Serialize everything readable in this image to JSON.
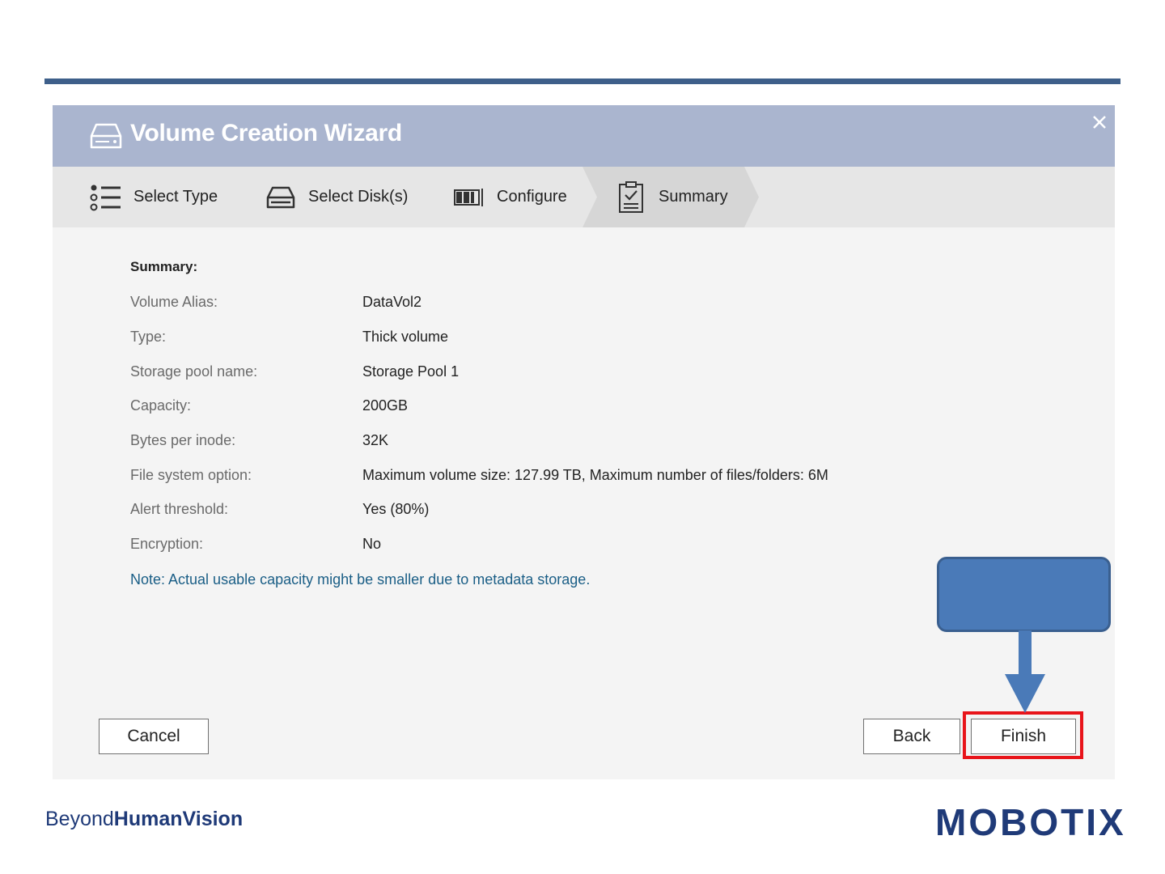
{
  "dialog": {
    "title": "Volume Creation Wizard",
    "close_icon": "close-icon"
  },
  "steps": [
    {
      "label": "Select Type",
      "icon": "list-icon"
    },
    {
      "label": "Select Disk(s)",
      "icon": "disk-icon"
    },
    {
      "label": "Configure",
      "icon": "configure-icon"
    },
    {
      "label": "Summary",
      "icon": "clipboard-check-icon",
      "active": true
    }
  ],
  "summary": {
    "heading": "Summary:",
    "rows": [
      {
        "key": "Volume Alias:",
        "value": "DataVol2"
      },
      {
        "key": "Type:",
        "value": "Thick volume"
      },
      {
        "key": "Storage pool name:",
        "value": "Storage Pool 1"
      },
      {
        "key": "Capacity:",
        "value": "200GB"
      },
      {
        "key": "Bytes per inode:",
        "value": "32K"
      },
      {
        "key": "File system option:",
        "value": "Maximum volume size: 127.99 TB, Maximum number of files/folders: 6M"
      },
      {
        "key": "Alert threshold:",
        "value": "Yes (80%)"
      },
      {
        "key": "Encryption:",
        "value": "No"
      }
    ],
    "note": "Note: Actual usable capacity might be smaller due to metadata storage."
  },
  "buttons": {
    "cancel": "Cancel",
    "back": "Back",
    "finish": "Finish"
  },
  "colors": {
    "titlebar": "#aab5cf",
    "highlight": "#e8141a",
    "callout": "#4a7ab8",
    "brand": "#1f3a78",
    "note": "#1a5e86"
  },
  "footer": {
    "tagline_light": "Beyond",
    "tagline_bold_1": "Human",
    "tagline_bold_2": "Vision",
    "logo": "MOBOTIX"
  }
}
